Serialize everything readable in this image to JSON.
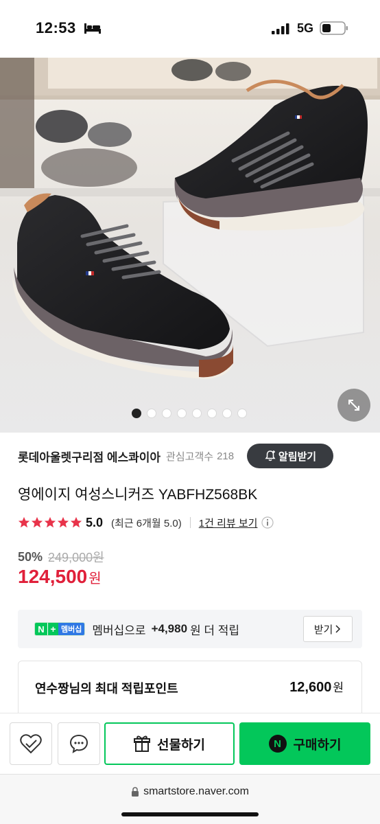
{
  "status_bar": {
    "time": "12:53",
    "network": "5G"
  },
  "product": {
    "store_name": "롯데아울렛구리점 에스콰이아",
    "interest_label": "관심고객수",
    "interest_count": "218",
    "notify_label": "알림받기",
    "title": "영에이지 여성스니커즈 YABFHZ568BK",
    "rating": "5.0",
    "rating_stars": 5,
    "rating_recent": "(최근 6개월 5.0)",
    "review_link": "1건 리뷰 보기",
    "discount_rate": "50%",
    "original_price": "249,000원",
    "sale_price": "124,500",
    "price_unit": "원"
  },
  "gallery": {
    "image_count": 8,
    "active_index": 0
  },
  "membership": {
    "badge_n": "N",
    "badge_plus": "+",
    "badge_text": "멤버십",
    "text": "멤버십으로",
    "points": "+4,980",
    "suffix": "원 더 적립",
    "receive_label": "받기"
  },
  "points_box": {
    "label": "연수짱님의 최대 적립포인트",
    "value": "12,600",
    "unit": "원"
  },
  "actions": {
    "gift_label": "선물하기",
    "buy_label": "구매하기",
    "npay_letter": "N"
  },
  "browser": {
    "url": "smartstore.naver.com"
  },
  "colors": {
    "accent_green": "#03c75a",
    "price_red": "#e0203a",
    "star_red": "#e8334a"
  }
}
